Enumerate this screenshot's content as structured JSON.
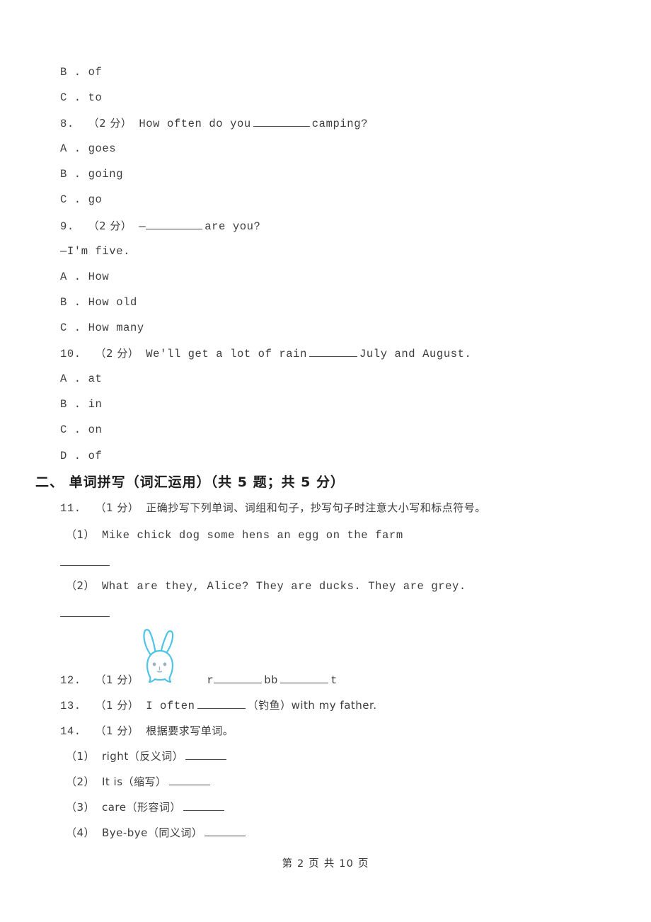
{
  "page": {
    "footer": "第 2 页 共 10 页",
    "background_color": "#ffffff",
    "text_color": "#3c3c3c"
  },
  "continued_options": [
    {
      "label": "B . of"
    },
    {
      "label": "C . to"
    }
  ],
  "questions": [
    {
      "number": "8.",
      "marks": "（2 分）",
      "stem_before": "How often do you",
      "stem_after": "camping?",
      "options": [
        {
          "label": "A . goes"
        },
        {
          "label": "B . going"
        },
        {
          "label": "C . go"
        }
      ]
    },
    {
      "number": "9.",
      "marks": "（2 分）",
      "stem_before": "—",
      "stem_after": "are you?",
      "stem_line2": "—I'm five.",
      "options": [
        {
          "label": "A . How"
        },
        {
          "label": "B . How old"
        },
        {
          "label": "C . How many"
        }
      ]
    },
    {
      "number": "10.",
      "marks": "（2 分）",
      "stem_before": "We'll get a lot of rain",
      "stem_after": "July and August.",
      "options": [
        {
          "label": "A . at"
        },
        {
          "label": "B . in"
        },
        {
          "label": "C . on"
        },
        {
          "label": "D . of"
        }
      ]
    }
  ],
  "section_two": {
    "heading": "二、  单词拼写（词汇运用）（共 5 题；共 5 分）",
    "q11": {
      "number": "11.",
      "marks": "（1 分）",
      "prompt": "正确抄写下列单词、词组和句子，抄写句子时注意大小写和标点符号。",
      "items": [
        {
          "label": "（1）",
          "text": "Mike    chick    dog    some hens    an egg    on the farm"
        },
        {
          "label": "（2）",
          "text": "What are they, Alice? They are ducks.  They are grey."
        }
      ]
    },
    "q12": {
      "number": "12.",
      "marks": "（1 分）",
      "image": "rabbit-picture",
      "answer_pattern_a": "r",
      "answer_pattern_b": "bb",
      "answer_pattern_c": "t"
    },
    "q13": {
      "number": "13.",
      "marks": "（1 分）",
      "stem_before": "I often",
      "stem_after": "（钓鱼）with my father."
    },
    "q14": {
      "number": "14.",
      "marks": "（1 分）",
      "prompt": "根据要求写单词。",
      "items": [
        {
          "label": "（1）",
          "text": "right（反义词）"
        },
        {
          "label": "（2）",
          "text": "It is（缩写）"
        },
        {
          "label": "（3）",
          "text": "care（形容词）"
        },
        {
          "label": "（4）",
          "text": "Bye-bye（同义词）"
        }
      ]
    }
  },
  "colors": {
    "rabbit_outline": "#4FC3E8",
    "rabbit_fill": "#ffffff",
    "rabbit_eye": "#8fa9bd",
    "rule": "#4a4a4a"
  }
}
